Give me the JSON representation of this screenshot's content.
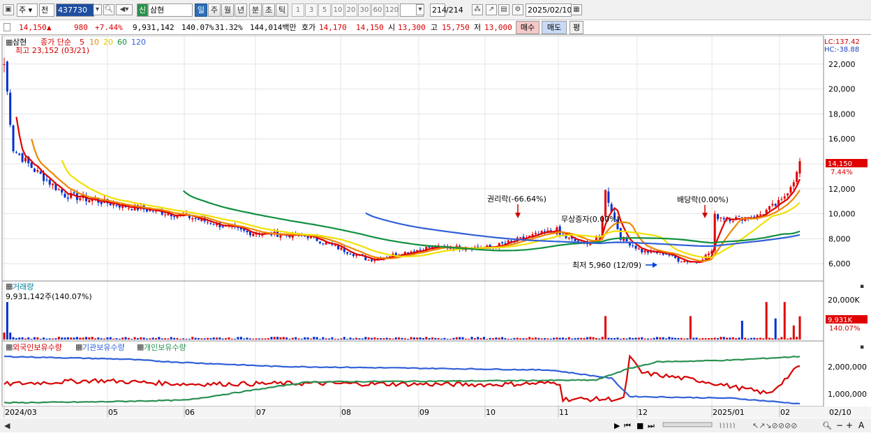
{
  "toolbar": {
    "market": "주",
    "prev": "전",
    "code": "437730",
    "stock_type": "신",
    "stock_name": "삼현",
    "periods": [
      "일",
      "주",
      "월",
      "년",
      "분",
      "초",
      "틱"
    ],
    "active_period": "일",
    "intervals": [
      "1",
      "3",
      "5",
      "10",
      "20",
      "30",
      "60",
      "120"
    ],
    "count": "214",
    "total": "/214",
    "date": "2025/02/10"
  },
  "quote": {
    "price": "14,150",
    "arrow": "▲",
    "change": "980",
    "change_pct": "+7.44%",
    "volume": "9,931,142",
    "vol_ratio": "140.07%",
    "turnover": "31.32%",
    "amount": "144,014백만",
    "ask_label": "호가",
    "ask": "14,170",
    "bid": "14,150",
    "open_label": "시",
    "open": "13,300",
    "high_label": "고",
    "high": "15,750",
    "low_label": "저",
    "low": "13,000",
    "buy": "매수",
    "sell": "매도",
    "eval": "평"
  },
  "price_panel": {
    "title": "삼현",
    "ma_label": "종가 단순",
    "ma_periods": [
      "5",
      "10",
      "20",
      "60",
      "120"
    ],
    "ma_colors": [
      "#e00000",
      "#ee8800",
      "#f0e000",
      "#109040",
      "#3060d8"
    ],
    "high_note": "최고 23,152 (03/21)",
    "lc": "LC:137.42",
    "hc": "HC:-38.88",
    "y_ticks": [
      "22,000",
      "20,000",
      "18,000",
      "16,000",
      "14,000",
      "12,000",
      "10,000",
      "8,000",
      "6,000"
    ],
    "current_box": "14,150",
    "current_pct": "7.44%",
    "ann_rights": "권리락(-66.64%)",
    "ann_free": "무상증자(0.00%)",
    "ann_div": "배당락(0.00%)",
    "ann_low": "최저 5,960 (12/09)"
  },
  "volume_panel": {
    "title": "거래량",
    "value": "9,931,142주(140.07%)",
    "y_tick": "20,000K",
    "box": "9,931K",
    "box_pct": "140.07%"
  },
  "holding_panel": {
    "series": [
      "외국인보유수량",
      "기관보유수량",
      "개인보유수량"
    ],
    "series_colors": [
      "#d80000",
      "#3060d8",
      "#2a9050"
    ],
    "y_ticks": [
      "2,000,000",
      "1,000,000"
    ]
  },
  "x_axis": {
    "labels": [
      "2024/03",
      "05",
      "06",
      "07",
      "08",
      "09",
      "10",
      "11",
      "12",
      "2025/01",
      "02"
    ],
    "right_label": "02/10"
  },
  "chart_data": {
    "type": "candlestick",
    "x_labels": [
      "2024/03",
      "05",
      "06",
      "07",
      "08",
      "09",
      "10",
      "11",
      "12",
      "2025/01",
      "02"
    ],
    "price_ylim": [
      5000,
      23500
    ],
    "close_anchors": [
      [
        0,
        22000
      ],
      [
        3,
        15200
      ],
      [
        10,
        13500
      ],
      [
        20,
        11500
      ],
      [
        40,
        10600
      ],
      [
        60,
        9800
      ],
      [
        80,
        8500
      ],
      [
        100,
        8200
      ],
      [
        120,
        6300
      ],
      [
        140,
        7300
      ],
      [
        160,
        7300
      ],
      [
        175,
        8300
      ],
      [
        182,
        8700
      ],
      [
        183,
        8300
      ],
      [
        190,
        7600
      ],
      [
        196,
        8000
      ],
      [
        198,
        11800
      ],
      [
        203,
        8100
      ],
      [
        210,
        7000
      ],
      [
        218,
        6800
      ],
      [
        222,
        6300
      ],
      [
        228,
        6100
      ],
      [
        233,
        7000
      ],
      [
        234,
        9800
      ],
      [
        240,
        9600
      ],
      [
        248,
        9800
      ],
      [
        256,
        11000
      ],
      [
        261,
        13200
      ],
      [
        262,
        14150
      ]
    ],
    "volume_spikes_k": [
      [
        1,
        16000
      ],
      [
        198,
        10000
      ],
      [
        226,
        10000
      ],
      [
        243,
        8000
      ],
      [
        251,
        16000
      ],
      [
        254,
        9000
      ],
      [
        257,
        16000
      ],
      [
        260,
        6000
      ],
      [
        262,
        9931
      ]
    ],
    "foreign_anchors": [
      [
        0,
        1.08
      ],
      [
        30,
        1.28
      ],
      [
        60,
        1.08
      ],
      [
        100,
        1.12
      ],
      [
        160,
        1.05
      ],
      [
        183,
        1.15
      ],
      [
        184,
        0.25
      ],
      [
        204,
        0.25
      ],
      [
        206,
        2.55
      ],
      [
        210,
        1.7
      ],
      [
        230,
        1.25
      ],
      [
        252,
        0.55
      ],
      [
        262,
        2.1
      ]
    ],
    "inst_anchors": [
      [
        0,
        2.6
      ],
      [
        40,
        2.45
      ],
      [
        55,
        2.3
      ],
      [
        90,
        2.05
      ],
      [
        160,
        1.9
      ],
      [
        180,
        1.85
      ],
      [
        200,
        1.4
      ],
      [
        206,
        0.4
      ],
      [
        240,
        0.3
      ],
      [
        262,
        0.0
      ]
    ],
    "indiv_anchors": [
      [
        0,
        0.05
      ],
      [
        30,
        0.1
      ],
      [
        60,
        0.2
      ],
      [
        100,
        1.2
      ],
      [
        150,
        1.25
      ],
      [
        195,
        1.3
      ],
      [
        205,
        1.9
      ],
      [
        215,
        2.3
      ],
      [
        240,
        2.4
      ],
      [
        262,
        2.6
      ]
    ]
  }
}
